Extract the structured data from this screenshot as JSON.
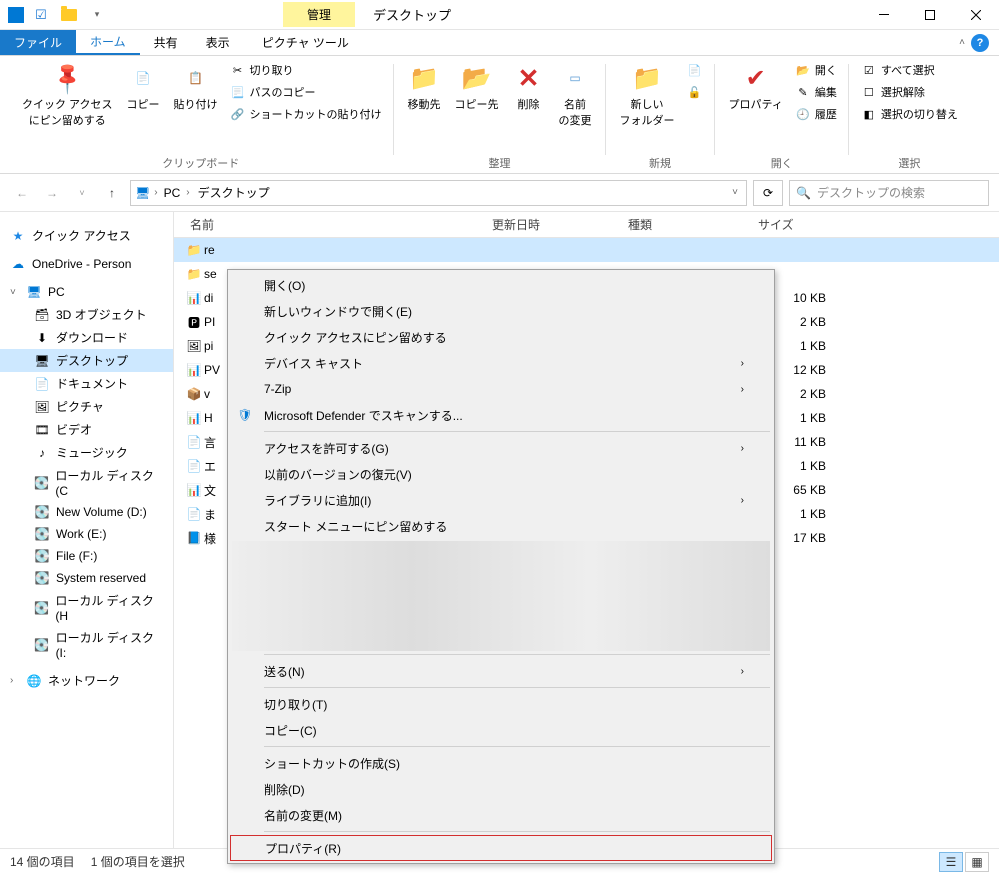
{
  "titlebar": {
    "manage_label": "管理",
    "title": "デスクトップ"
  },
  "tabs": {
    "file": "ファイル",
    "home": "ホーム",
    "share": "共有",
    "view": "表示",
    "picture_tools": "ピクチャ ツール"
  },
  "ribbon": {
    "clipboard": {
      "pin": "クイック アクセス\nにピン留めする",
      "copy": "コピー",
      "paste": "貼り付け",
      "cut": "切り取り",
      "copy_path": "パスのコピー",
      "paste_shortcut": "ショートカットの貼り付け",
      "label": "クリップボード"
    },
    "organize": {
      "move": "移動先",
      "copy_to": "コピー先",
      "delete": "削除",
      "rename": "名前\nの変更",
      "label": "整理"
    },
    "new": {
      "new_folder": "新しい\nフォルダー",
      "label": "新規"
    },
    "open": {
      "properties": "プロパティ",
      "open": "開く",
      "edit": "編集",
      "history": "履歴",
      "label": "開く"
    },
    "select": {
      "select_all": "すべて選択",
      "select_none": "選択解除",
      "invert": "選択の切り替え",
      "label": "選択"
    }
  },
  "address": {
    "pc": "PC",
    "desktop": "デスクトップ"
  },
  "search": {
    "placeholder": "デスクトップの検索"
  },
  "sidebar": {
    "quick_access": "クイック アクセス",
    "onedrive": "OneDrive - Person",
    "pc": "PC",
    "items": [
      "3D オブジェクト",
      "ダウンロード",
      "デスクトップ",
      "ドキュメント",
      "ピクチャ",
      "ビデオ",
      "ミュージック",
      "ローカル ディスク (C",
      "New Volume (D:)",
      "Work (E:)",
      "File (F:)",
      "System reserved",
      "ローカル ディスク (H",
      "ローカル ディスク (I:"
    ],
    "network": "ネットワーク"
  },
  "columns": {
    "name": "名前",
    "date": "更新日時",
    "type": "種類",
    "size": "サイズ"
  },
  "files": [
    {
      "name": "re",
      "size": "",
      "selected": true,
      "icon": "folder"
    },
    {
      "name": "se",
      "size": "",
      "icon": "folder"
    },
    {
      "name": "di",
      "size": "10 KB",
      "icon": "xls"
    },
    {
      "name": "PI",
      "size": "2 KB",
      "icon": "ps"
    },
    {
      "name": "pi",
      "size": "1 KB",
      "icon": "img"
    },
    {
      "name": "PV",
      "size": "12 KB",
      "icon": "xls"
    },
    {
      "name": "v",
      "size": "2 KB",
      "icon": "vm"
    },
    {
      "name": "H",
      "size": "1 KB",
      "icon": "xls"
    },
    {
      "name": "言",
      "size": "11 KB",
      "icon": "doc"
    },
    {
      "name": "エ",
      "size": "1 KB",
      "icon": "doc"
    },
    {
      "name": "文",
      "size": "65 KB",
      "icon": "xls"
    },
    {
      "name": "ま",
      "size": "1 KB",
      "icon": "doc"
    },
    {
      "name": "様",
      "size": "17 KB",
      "icon": "word"
    }
  ],
  "context_menu": {
    "open": "開く(O)",
    "open_new": "新しいウィンドウで開く(E)",
    "pin_quick": "クイック アクセスにピン留めする",
    "cast": "デバイス キャスト",
    "seven_zip": "7-Zip",
    "defender": "Microsoft Defender でスキャンする...",
    "give_access": "アクセスを許可する(G)",
    "restore_prev": "以前のバージョンの復元(V)",
    "include_lib": "ライブラリに追加(I)",
    "pin_start": "スタート メニューにピン留めする",
    "send_to": "送る(N)",
    "cut": "切り取り(T)",
    "copy": "コピー(C)",
    "create_shortcut": "ショートカットの作成(S)",
    "delete": "削除(D)",
    "rename": "名前の変更(M)",
    "properties": "プロパティ(R)"
  },
  "statusbar": {
    "item_count": "14 個の項目",
    "selection": "1 個の項目を選択"
  }
}
